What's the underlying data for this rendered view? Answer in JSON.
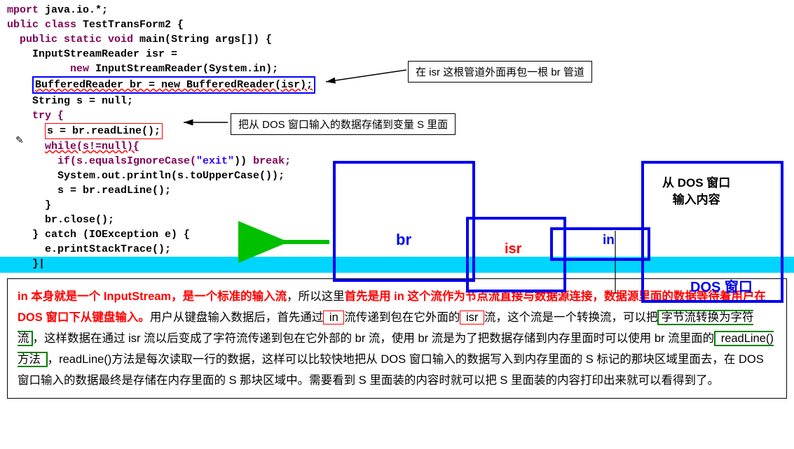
{
  "code": {
    "l1_a": "mport ",
    "l1_b": "java.io.*",
    ";": ";",
    "l2_a": "ublic ",
    "l2_b": "class ",
    "l2_c": "TestTransForm2 {",
    "l3_a": "  public static void ",
    "l3_b": "main",
    "l3_c": "(",
    "l3_d": "String",
    "l3_e": " args[]) {",
    "l4_a": "    InputStreamReader isr =",
    "l5_a": "          new ",
    "l5_b": "InputStreamReader(",
    "l5_c": "System.in",
    "l5_d": ");",
    "l6_a": "BufferedReader br = new BufferedReader(isr);",
    "l7_a": "    String s = null;",
    "l8_a": "    try {",
    "l9_a": "s = br.readLine();",
    "l10_a": "while(s!=null){",
    "l11_a": "        if(s.equalsIgnoreCase(",
    "l11_b": "\"exit\"",
    "l11_c": ")) ",
    "l11_d": "break;",
    "l12_a": "        System.out.println(s.toUpperCase());",
    "l13_a": "        s = br.readLine();",
    "l14_a": "      }",
    "l15_a": "      br.close();",
    "l16_a": "    } catch (IOException e) {",
    "l17_a": "      e.printStackTrace();",
    "l18_a": "    }|"
  },
  "callouts": {
    "c1": "在 isr 这根管道外面再包一根 br 管道",
    "c2": "把从 DOS 窗口输入的数据存储到变量 S 里面"
  },
  "diagram": {
    "br": "br",
    "isr": "isr",
    "in": "in",
    "dos_window": "DOS 窗口",
    "dos_input_l1": "从 DOS 窗口",
    "dos_input_l2": "输入内容"
  },
  "explain": {
    "p1_r1": "in 本身就是一个 InputStream，是一个标准的输入流",
    "p1_b1": "，所以这里",
    "p1_r2": "首先是用 in 这个流作为节点流直接与数据源连接，数据源里面的数据等待着用户在 DOS 窗口下从键盘输入。",
    "p1_b2": "用户从键盘输入数据后，首先通过",
    "p1_in": " in ",
    "p1_b3": "流传递到包在它外面的",
    "p1_isr": " isr ",
    "p1_b4": "流，这个流是一个转换流，可以把",
    "p1_g1": "字节流转换为字符流",
    "p1_b5": "，这样数据在通过 isr 流以后变成了字符流传递到包在它外部的 br 流，使用 br 流是为了把数据存储到内存里面时可以使用 br 流里面的",
    "p1_g2": " readLine()方法 ",
    "p1_b6": "，readLine()方法是每次读取一行的数据，这样可以比较快地把从 DOS 窗口输入的数据写入到内存里面的 S 标记的那块区域里面去，在 DOS 窗口输入的数据最终是存储在内存里面的 S 那块区域中。需要看到 S 里面装的内容时就可以把 S 里面装的内容打印出来就可以看得到了。"
  }
}
